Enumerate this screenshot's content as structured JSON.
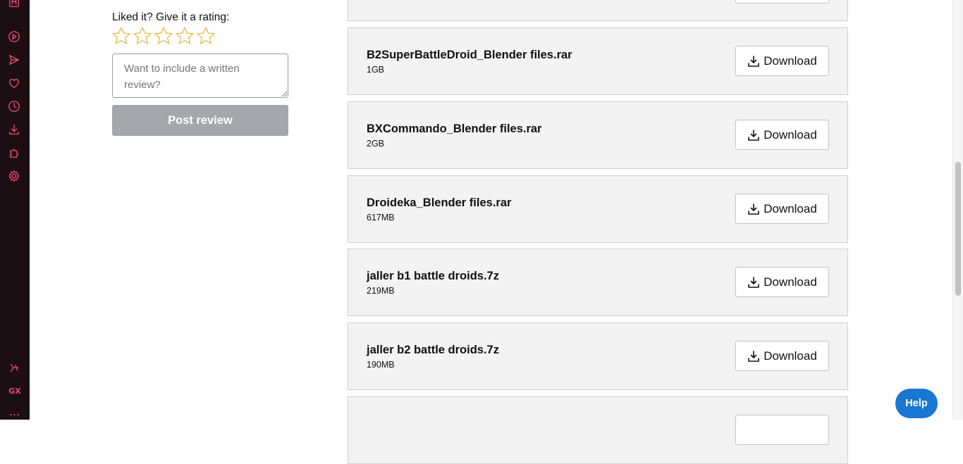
{
  "review": {
    "prompt": "Liked it? Give it a rating:",
    "stars_total": 5,
    "stars_selected": 0,
    "placeholder": "Want to include a written review?",
    "post_label": "Post review"
  },
  "files": [
    {
      "name": "",
      "size": "",
      "download_label": ""
    },
    {
      "name": "B2SuperBattleDroid_Blender files.rar",
      "size": "1GB",
      "download_label": "Download"
    },
    {
      "name": "BXCommando_Blender files.rar",
      "size": "2GB",
      "download_label": "Download"
    },
    {
      "name": "Droideka_Blender files.rar",
      "size": "617MB",
      "download_label": "Download"
    },
    {
      "name": "jaller b1 battle droids.7z",
      "size": "219MB",
      "download_label": "Download"
    },
    {
      "name": "jaller b2 battle droids.7z",
      "size": "190MB",
      "download_label": "Download"
    },
    {
      "name": "",
      "size": "",
      "download_label": ""
    }
  ],
  "help": {
    "label": "Help"
  },
  "sidebar": {
    "items": [
      "play-icon",
      "send-icon",
      "heart-icon",
      "clock-icon",
      "download-icon",
      "puzzle-icon",
      "settings-icon",
      "twitch-icon"
    ],
    "gx_label": "GX",
    "more_label": "..."
  },
  "colors": {
    "sidebar_bg": "#1b0f14",
    "sidebar_accent": "#e8456b",
    "help_bg": "#1976d2",
    "star": "#e4b43a",
    "post_disabled": "#a4a8ad"
  }
}
